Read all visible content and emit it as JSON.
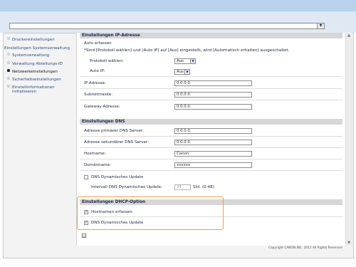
{
  "address_bar": {
    "arrow_icon": "chevron-down-icon"
  },
  "sidebar": {
    "items": [
      {
        "label": "Druckereinstellungen"
      },
      {
        "label": "Einstellungen Systemverwaltung"
      },
      {
        "label": "Systemverwaltung"
      },
      {
        "label": "Verwaltung Abteilungs-ID"
      },
      {
        "label": "Netzwerkeinstellungen"
      },
      {
        "label": "Sicherheitseinstellungen"
      },
      {
        "label": "Einstellinformationen"
      },
      {
        "label": "initialisieren"
      }
    ]
  },
  "ip_section": {
    "title": "Einstellungen IP-Adresse",
    "auto_label": "Auto erfassen",
    "note": "*Sind [Protokoll wählen] und [Auto IP] auf [Aus] eingestellt, wird [Automatisch erhalten] ausgeschaltet.",
    "protocol_label": "Protokoll wählen:",
    "protocol_value": "Aus",
    "autoip_label": "Auto IP:",
    "autoip_value": "Aus",
    "ip_label": "IP-Adresse:",
    "ip_value": "0.0.0.0.",
    "subnet_label": "Subnetmaske:",
    "subnet_value": "0.0.0.0.",
    "gateway_label": "Gateway-Adresse:",
    "gateway_value": "0.0.0.0."
  },
  "dns_section": {
    "title": "Einstellungen DNS",
    "primary_label": "Adresse primärer DNS Server:",
    "primary_value": "0.0.0.0.",
    "secondary_label": "Adresse sekundärer DNS Server:",
    "secondary_value": "0.0.0.0.",
    "hostname_label": "Hostname:",
    "hostname_value": "Canon",
    "domain_label": "Domänname:",
    "domain_value": "xxxxxx",
    "dynamic_label": "DNS Dynamisches Update",
    "interval_label": "Intervall DNS Dynamisches Update:",
    "interval_value": "24",
    "interval_unit": "Std. (0-48)"
  },
  "dhcp_section": {
    "title": "Einstellungen DHCP-Option",
    "hostname_label": "Hostnamen erfassen",
    "dynamic_label": "DNS Dynamisches Update"
  },
  "footer": {
    "copyright": "Copyright CANON INC. 2012 All Rights Reserved"
  },
  "colors": {
    "highlight": "#f1a332",
    "section_header": "#d7d7d7",
    "topbar": "#b7d2ea"
  }
}
